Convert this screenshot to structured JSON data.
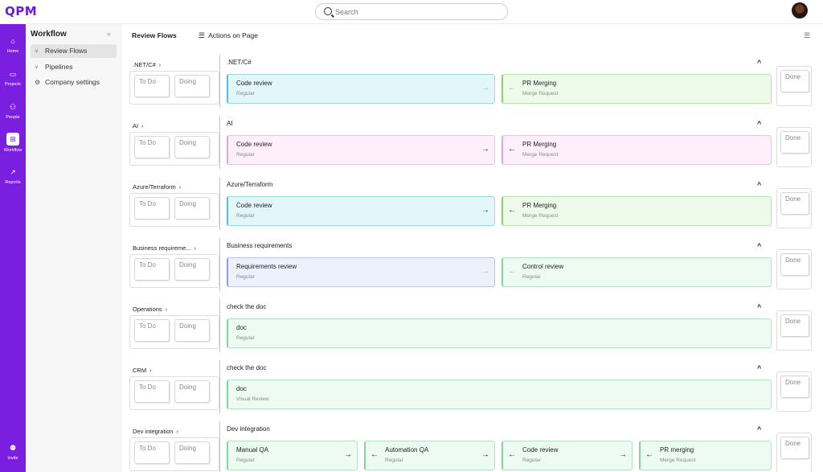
{
  "app": {
    "logo": "QPM"
  },
  "search": {
    "placeholder": "Search"
  },
  "rail": [
    {
      "label": "Home",
      "icon": "home-icon",
      "glyph": "⌂"
    },
    {
      "label": "Projects",
      "icon": "folder-icon",
      "glyph": "▭"
    },
    {
      "label": "People",
      "icon": "people-icon",
      "glyph": "⚇"
    },
    {
      "label": "Workflow",
      "icon": "workflow-icon",
      "glyph": "⊞"
    },
    {
      "label": "Reports",
      "icon": "reports-icon",
      "glyph": "↗"
    },
    {
      "label": "Invite",
      "icon": "invite-icon",
      "glyph": "⚉"
    }
  ],
  "sidebar": {
    "title": "Workflow",
    "collapse_glyph": "«",
    "items": [
      {
        "label": "Review Flows",
        "glyph": "⑂"
      },
      {
        "label": "Pipelines",
        "glyph": "⑂"
      },
      {
        "label": "Company settings",
        "glyph": "⚙"
      }
    ]
  },
  "main": {
    "tab_review": "Review Flows",
    "tab_actions": "Actions on Page",
    "actions_glyph": "☰",
    "filter_glyph": "☰"
  },
  "stages": {
    "todo": "To Do",
    "doing": "Doing",
    "done": "Done"
  },
  "glyphs": {
    "chevron_right": "›",
    "collapse": "^",
    "arrow_right": "→",
    "arrow_left": "←"
  },
  "flows": [
    {
      "label": ".NET/C#",
      "name": ".NET/C#",
      "cards": [
        {
          "name": "Code review",
          "type": "Regular"
        },
        {
          "name": "PR Merging",
          "type": "Merge Request"
        }
      ]
    },
    {
      "label": "AI",
      "name": "AI",
      "cards": [
        {
          "name": "Code review",
          "type": "Regular"
        },
        {
          "name": "PR Merging",
          "type": "Merge Request"
        }
      ]
    },
    {
      "label": "Azure/Terraform",
      "name": "Azure/Terraform",
      "cards": [
        {
          "name": "Code review",
          "type": "Regular"
        },
        {
          "name": "PR Merging",
          "type": "Merge Request"
        }
      ]
    },
    {
      "label": "Business requireme...",
      "name": "Business requirements",
      "cards": [
        {
          "name": "Requirements review",
          "type": "Regular"
        },
        {
          "name": "Control review",
          "type": "Regular"
        }
      ]
    },
    {
      "label": "Operations",
      "name": "check the doc",
      "cards": [
        {
          "name": "doc",
          "type": "Regular"
        }
      ]
    },
    {
      "label": "CRM",
      "name": "check the doc",
      "cards": [
        {
          "name": "doc",
          "type": "Visual Review"
        }
      ]
    },
    {
      "label": "Dev integration",
      "name": "Dev integration",
      "cards": [
        {
          "name": "Manual QA",
          "type": "Regular"
        },
        {
          "name": "Automation QA",
          "type": "Regular"
        },
        {
          "name": "Code review",
          "type": "Regular"
        },
        {
          "name": "PR merging",
          "type": "Merge Request"
        }
      ]
    }
  ]
}
